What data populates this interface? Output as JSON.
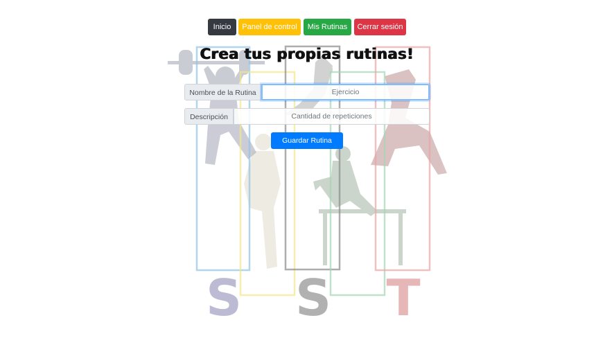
{
  "nav": {
    "home_label": "Inicio",
    "panel_label": "Panel de control",
    "routines_label": "Mis Rutinas",
    "logout_label": "Cerrar sesión"
  },
  "page_title": "Crea tus propias rutinas!",
  "form": {
    "name_label": "Nombre de la Rutina",
    "name_placeholder": "Ejercicio",
    "description_label": "Descripción",
    "description_placeholder": "Cantidad de repeticiones",
    "save_label": "Guardar Rutina"
  },
  "colors": {
    "dark": "#343a40",
    "warning": "#ffc107",
    "success": "#28a745",
    "danger": "#dc3545",
    "primary": "#007bff"
  }
}
